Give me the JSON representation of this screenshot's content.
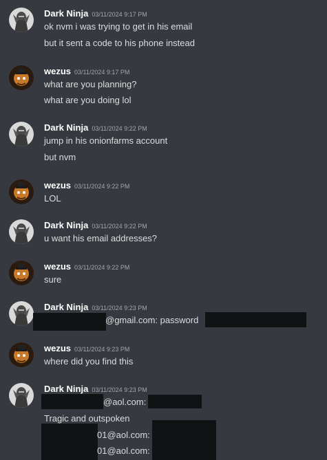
{
  "colors": {
    "background": "#36393f",
    "username": "#ffffff",
    "timestamp": "#a3a6aa",
    "message_text": "#dcddde",
    "redaction": "#111214"
  },
  "messages": [
    {
      "author": "Dark Ninja",
      "avatar": "dark-ninja-avatar",
      "timestamp": "03/11/2024 9:17 PM",
      "lines": [
        "ok nvm i was trying to get in his email",
        "but it sent a code to his phone instead"
      ]
    },
    {
      "author": "wezus",
      "avatar": "wezus-avatar",
      "timestamp": "03/11/2024 9:17 PM",
      "lines": [
        "what are you planning?",
        "what are you doing lol"
      ]
    },
    {
      "author": "Dark Ninja",
      "avatar": "dark-ninja-avatar",
      "timestamp": "03/11/2024 9:22 PM",
      "lines": [
        "jump in his onionfarms account",
        "but nvm"
      ]
    },
    {
      "author": "wezus",
      "avatar": "wezus-avatar",
      "timestamp": "03/11/2024 9:22 PM",
      "lines": [
        "LOL"
      ]
    },
    {
      "author": "Dark Ninja",
      "avatar": "dark-ninja-avatar",
      "timestamp": "03/11/2024 9:22 PM",
      "lines": [
        "u want his email addresses?"
      ]
    },
    {
      "author": "wezus",
      "avatar": "wezus-avatar",
      "timestamp": "03/11/2024 9:22 PM",
      "lines": [
        "sure"
      ]
    },
    {
      "author": "Dark Ninja",
      "avatar": "dark-ninja-avatar",
      "timestamp": "03/11/2024 9:23 PM",
      "lines": [
        "@gmail.com: password"
      ]
    },
    {
      "author": "wezus",
      "avatar": "wezus-avatar",
      "timestamp": "03/11/2024 9:23 PM",
      "lines": [
        "where did you find this"
      ]
    },
    {
      "author": "Dark Ninja",
      "avatar": "dark-ninja-avatar",
      "timestamp": "03/11/2024 9:23 PM",
      "lines": [
        "@aol.com:",
        "Tragic and outspoken",
        "01@aol.com:",
        "01@aol.com:"
      ]
    }
  ]
}
